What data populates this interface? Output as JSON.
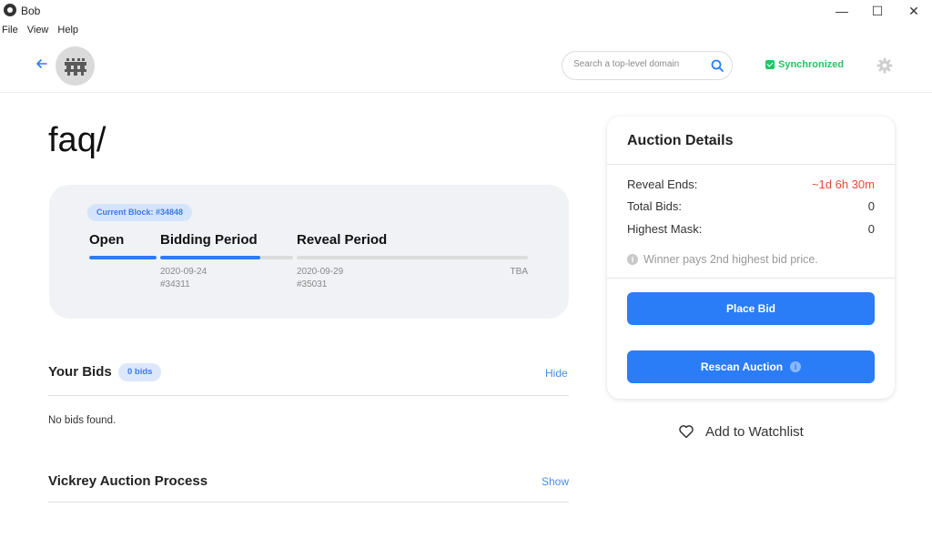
{
  "window": {
    "title": "Bob",
    "minimize": "—",
    "maximize": "☐",
    "close": "✕"
  },
  "menu": [
    "File",
    "View",
    "Help"
  ],
  "header": {
    "search_placeholder": "Search a top-level domain",
    "sync_label": "Synchronized"
  },
  "domain": {
    "name": "faq/"
  },
  "status": {
    "current_block": "Current Block: #34848",
    "phases": [
      {
        "label": "Open",
        "progress": 1.0,
        "date": "",
        "block": ""
      },
      {
        "label": "Bidding Period",
        "progress": 0.75,
        "date": "2020-09-24",
        "block": "#34311"
      },
      {
        "label": "Reveal Period",
        "progress": 0.0,
        "date": "2020-09-29",
        "block": "#35031",
        "end": "TBA"
      }
    ]
  },
  "your_bids": {
    "title": "Your Bids",
    "badge": "0 bids",
    "link": "Hide",
    "empty": "No bids found."
  },
  "vickrey": {
    "title": "Vickrey Auction Process",
    "link": "Show"
  },
  "auction": {
    "title": "Auction Details",
    "rows": [
      {
        "label": "Reveal Ends:",
        "value": "~1d 6h 30m"
      },
      {
        "label": "Total Bids:",
        "value": "0"
      },
      {
        "label": "Highest Mask:",
        "value": "0"
      }
    ],
    "note": "Winner pays 2nd highest bid price.",
    "place_bid": "Place Bid",
    "rescan": "Rescan Auction"
  },
  "watchlist": {
    "label": "Add to Watchlist"
  },
  "colors": {
    "accent": "#2b7cf7",
    "success": "#27c266",
    "danger": "#e54b3a"
  }
}
